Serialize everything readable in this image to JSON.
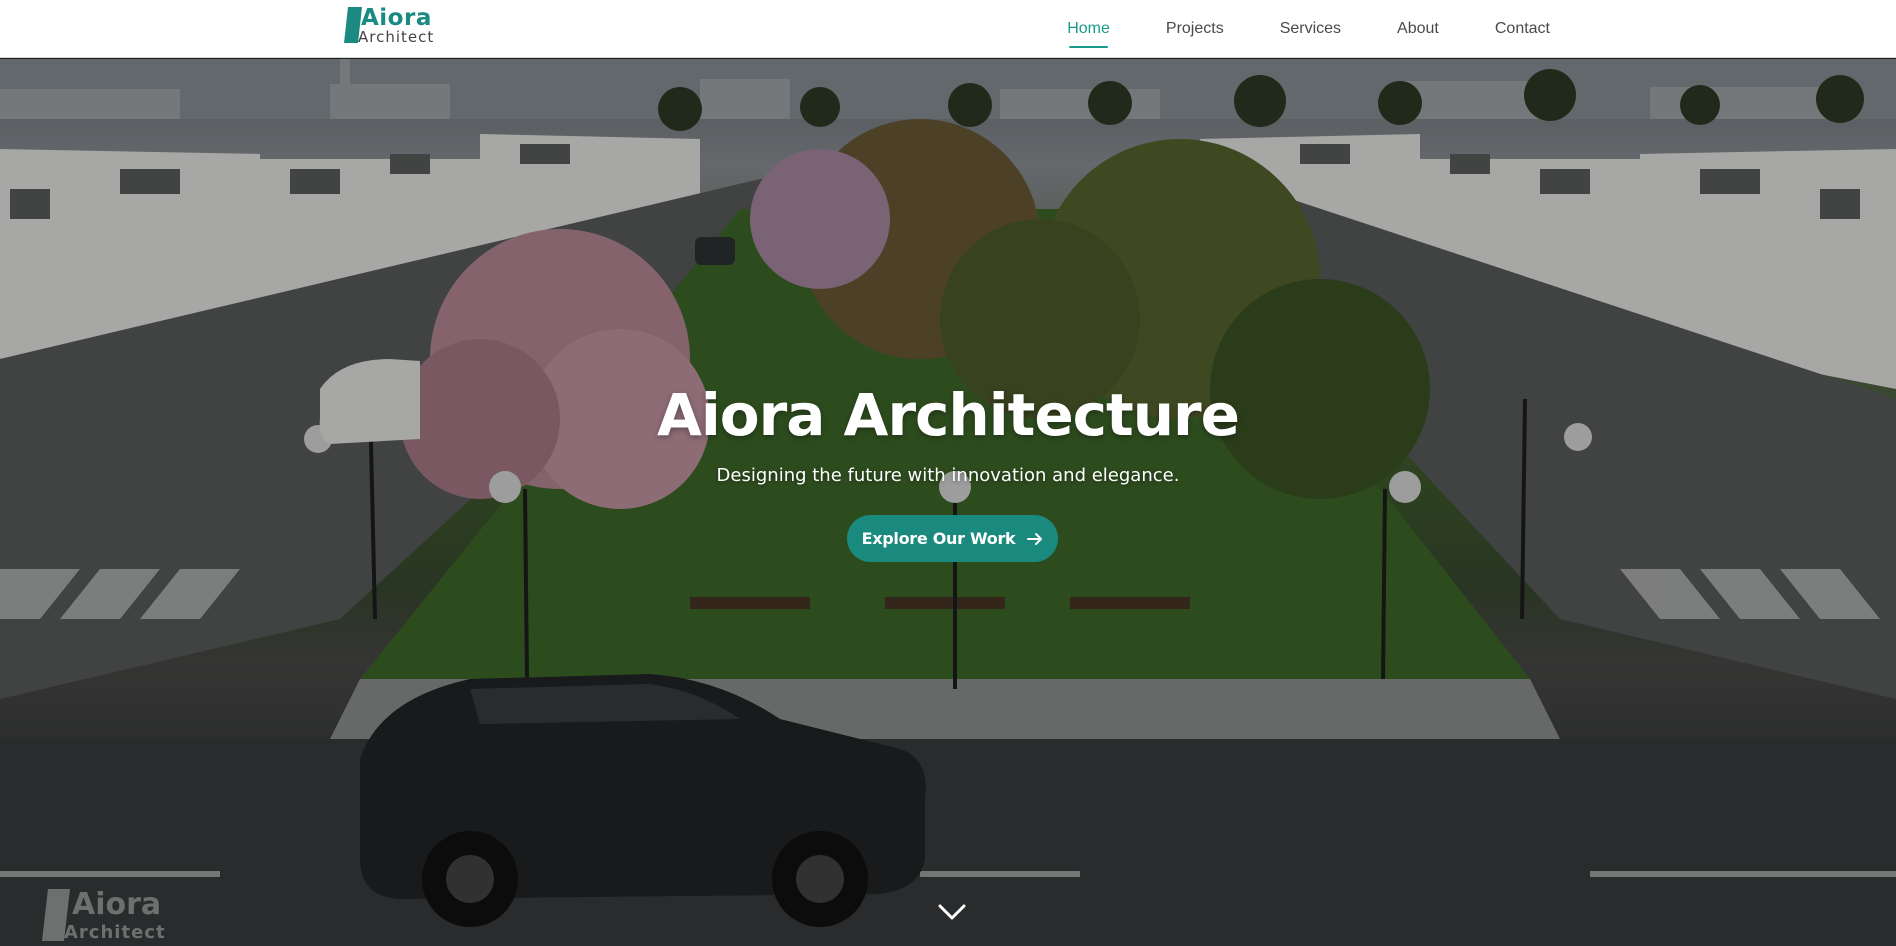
{
  "brand": {
    "name": "Aiora",
    "tagline": "Architect",
    "accent": "#1a8a83"
  },
  "nav": {
    "items": [
      {
        "label": "Home",
        "active": true
      },
      {
        "label": "Projects",
        "active": false
      },
      {
        "label": "Services",
        "active": false
      },
      {
        "label": "About",
        "active": false
      },
      {
        "label": "Contact",
        "active": false
      }
    ]
  },
  "hero": {
    "title": "Aiora Architecture",
    "subtitle": "Designing the future with innovation and elegance.",
    "cta_label": "Explore Our Work",
    "cta_icon": "arrow-right-icon",
    "scroll_icon": "chevron-down-icon",
    "cta_color": "#1a8a7e"
  },
  "watermark": {
    "name": "Aiora",
    "tagline": "Architect"
  }
}
